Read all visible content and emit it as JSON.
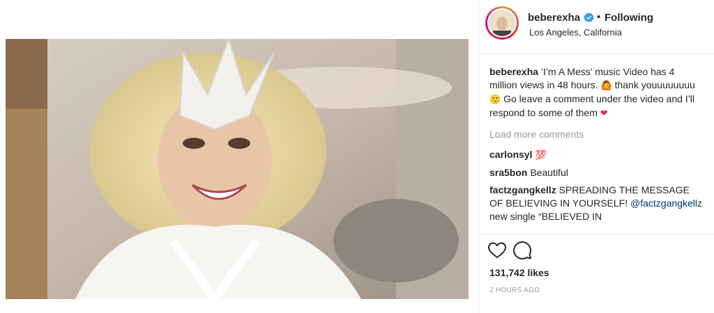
{
  "post": {
    "header": {
      "username": "beberexha",
      "separator": "•",
      "follow_status": "Following",
      "location": "Los Angeles, California"
    },
    "caption": {
      "username": "beberexha",
      "text_1": " ‘I’m A Mess’ music Video has 4 million views in 48 hours. ",
      "emoji_1": "🙆",
      "text_2": " thank youuuuuuuu ",
      "emoji_2": "🙂",
      "text_3": " Go leave a comment under the video and I’ll respond to some of them ",
      "emoji_3": "❤"
    },
    "load_more_label": "Load more comments",
    "comments": [
      {
        "username": "carlonsyl",
        "text": " 💯"
      },
      {
        "username": "sra5bon",
        "text": " Beautiful"
      },
      {
        "username": "factzgangkellz",
        "text": " SPREADING THE MESSAGE OF BELIEVING IN YOURSELF! ",
        "mention": "@factzgangkellz",
        "tail": " new single “BELIEVED IN"
      }
    ],
    "likes": "131,742 likes",
    "timestamp": "2 HOURS AGO",
    "icons": {
      "like": "heart-outline-icon",
      "comment": "speech-bubble-icon",
      "verified": "verified-badge-icon"
    },
    "colors": {
      "verified": "#3897f0",
      "text": "#262626",
      "muted": "#999999",
      "link": "#003569"
    }
  }
}
